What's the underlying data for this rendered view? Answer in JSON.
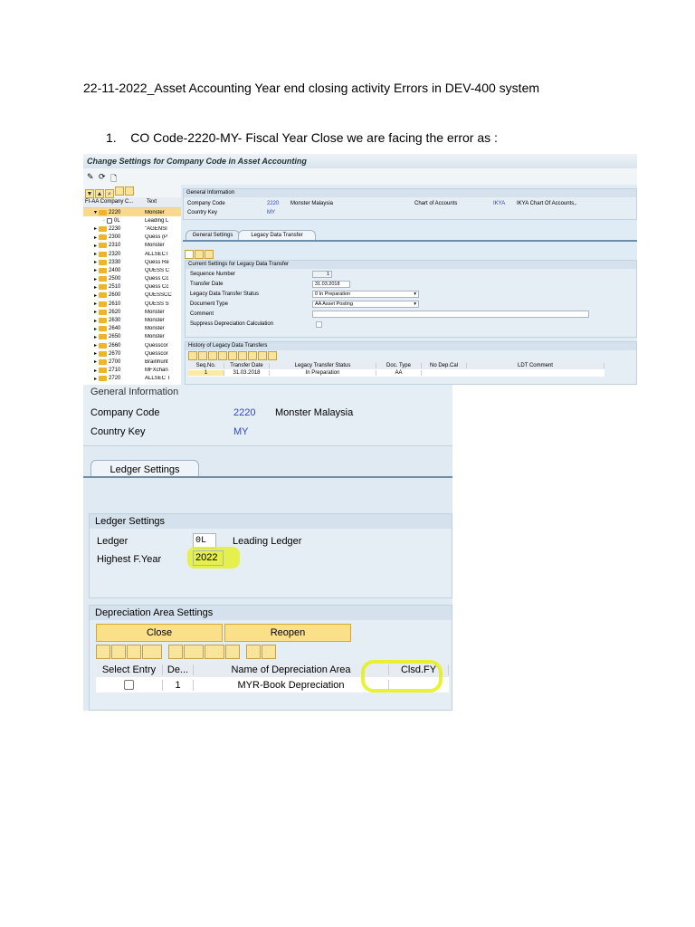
{
  "doc": {
    "title": "22-11-2022_Asset Accounting Year end closing activity Errors in DEV-400 system",
    "step_num": "1.",
    "step_text": "CO Code-2220-MY- Fiscal Year Close we are facing the error as :"
  },
  "s1": {
    "title": "Change Settings for Company Code in Asset Accounting",
    "tree": {
      "col1": "FI-AA Company C...",
      "col2": "Text",
      "items": [
        {
          "code": "2220",
          "text": "Monster"
        },
        {
          "code": "0L",
          "text": "Leading L"
        },
        {
          "code": "2230",
          "text": "\"AGENSI"
        },
        {
          "code": "2300",
          "text": "Quess (P"
        },
        {
          "code": "2310",
          "text": "Monster"
        },
        {
          "code": "2320",
          "text": "ALLSECT"
        },
        {
          "code": "2330",
          "text": "Quess Re"
        },
        {
          "code": "2400",
          "text": "QUESS C"
        },
        {
          "code": "2500",
          "text": "Quess Cc"
        },
        {
          "code": "2510",
          "text": "Quess Cc"
        },
        {
          "code": "2600",
          "text": "QUESSCC"
        },
        {
          "code": "2610",
          "text": "QUESS S"
        },
        {
          "code": "2620",
          "text": "Monster"
        },
        {
          "code": "2630",
          "text": "Monster"
        },
        {
          "code": "2640",
          "text": "Monster"
        },
        {
          "code": "2650",
          "text": "Monster"
        },
        {
          "code": "2660",
          "text": "Quesscor"
        },
        {
          "code": "2670",
          "text": "Quesscor"
        },
        {
          "code": "2700",
          "text": "Brainhunt"
        },
        {
          "code": "2710",
          "text": "MFXchan"
        },
        {
          "code": "2720",
          "text": "ALLSEC T"
        }
      ]
    },
    "general": {
      "header": "General Information",
      "company_code_label": "Company Code",
      "company_code": "2220",
      "company_name": "Monster Malaysia",
      "country_key_label": "Country Key",
      "country_key": "MY",
      "coa_label": "Chart of Accounts",
      "coa": "IKYA",
      "coa_name": "IKYA Chart Of Accounts,."
    },
    "tabs": [
      "General Settings",
      "Legacy Data Transfer"
    ],
    "current": {
      "header": "Current Settings for Legacy Data Transfer",
      "seq_label": "Sequence Number",
      "seq": "1",
      "date_label": "Transfer Date",
      "date": "31.03.2018",
      "status_label": "Legacy Data Transfer Status",
      "status": "0 In Preparation",
      "doctype_label": "Document Type",
      "doctype": "AA Asset Posting",
      "comment_label": "Comment",
      "comment": "",
      "suppress_label": "Suppress Depreciation Calculation"
    },
    "history": {
      "header": "History of Legacy Data Transfers",
      "columns": [
        "Seq.No.",
        "Transfer Date",
        "Legacy Transfer Status",
        "Doc. Type",
        "No Dep.Cal",
        "LDT Comment"
      ],
      "row": [
        "1",
        "31.03.2018",
        "In Preparation",
        "AA",
        "",
        ""
      ]
    }
  },
  "s2": {
    "general_header": "General Information",
    "company_code_label": "Company Code",
    "company_code": "2220",
    "company_name": "Monster Malaysia",
    "country_key_label": "Country Key",
    "country_key": "MY",
    "tab": "Ledger Settings",
    "ledger": {
      "header": "Ledger Settings",
      "ledger_label": "Ledger",
      "ledger": "0L",
      "ledger_name": "Leading Ledger",
      "fy_label": "Highest F.Year",
      "fy": "2022"
    },
    "dep": {
      "header": "Depreciation Area Settings",
      "close": "Close",
      "reopen": "Reopen",
      "columns": [
        "Select Entry",
        "De...",
        "Name of Depreciation Area",
        "Clsd.FY"
      ],
      "row": {
        "de": "1",
        "name": "MYR-Book Depreciation",
        "clsd": ""
      }
    },
    "highlight_color": "#e6f014"
  }
}
